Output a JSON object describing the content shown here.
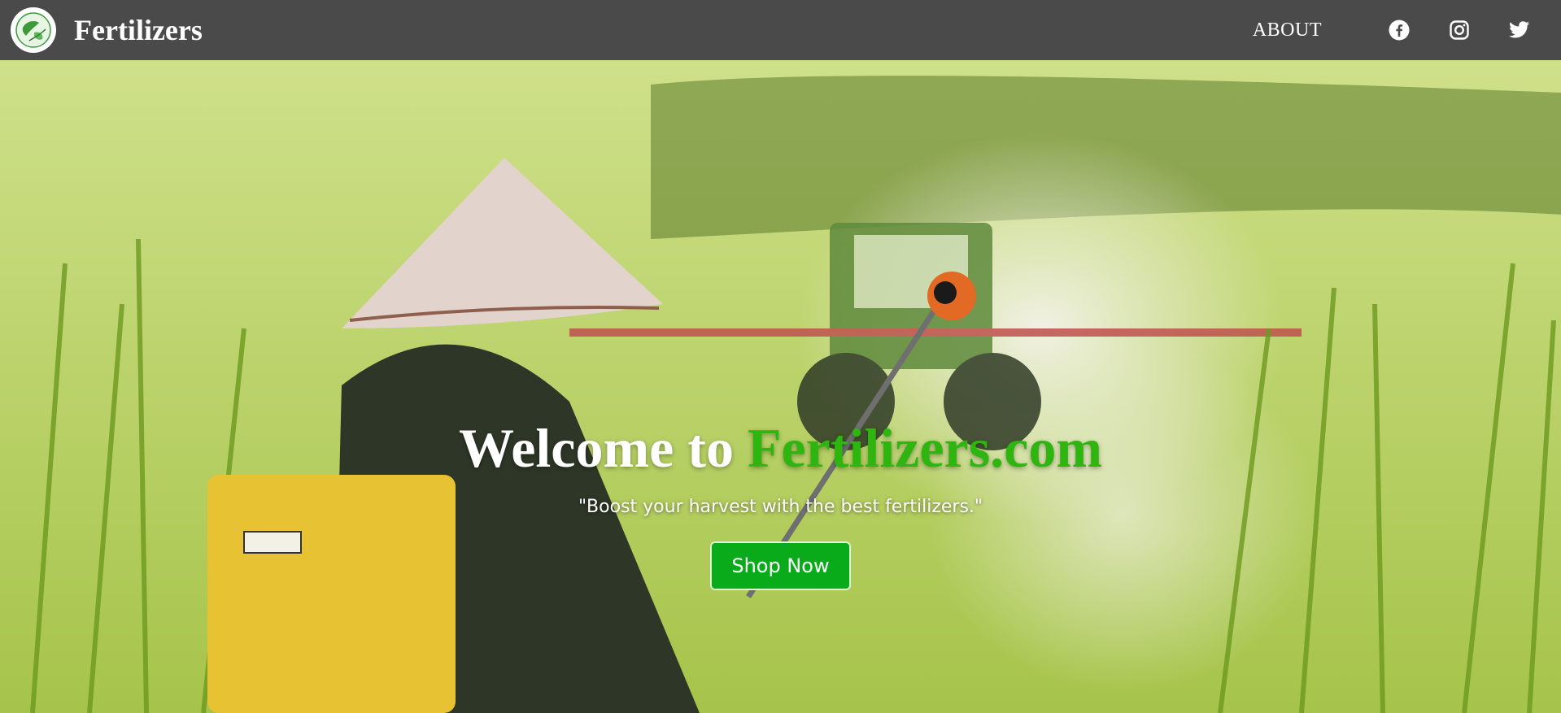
{
  "brand": {
    "name": "Fertilizers",
    "logo_icon": "globe-leaf-icon"
  },
  "nav": {
    "about_label": "ABOUT",
    "social": [
      {
        "name": "facebook-icon"
      },
      {
        "name": "instagram-icon"
      },
      {
        "name": "twitter-icon"
      }
    ]
  },
  "hero": {
    "title_prefix": "Welcome to",
    "title_accent": "Fertilizers.com",
    "tagline": "\"Boost your harvest with the best fertilizers.\"",
    "cta_label": "Shop Now",
    "background_image": "farmer spraying crops in a green field with tractor"
  },
  "colors": {
    "navbar": "#4a4a4a",
    "accent_green": "#2fb50f",
    "button_green": "#0aab1b",
    "text_white": "#ffffff"
  }
}
